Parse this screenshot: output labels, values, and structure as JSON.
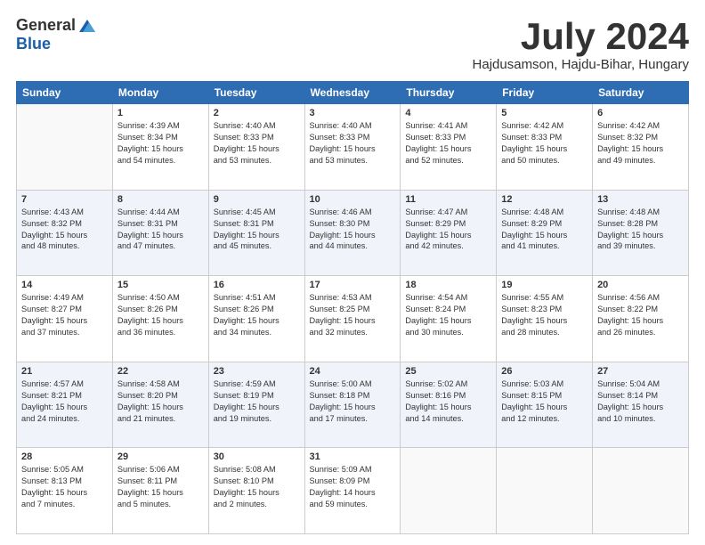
{
  "logo": {
    "general": "General",
    "blue": "Blue"
  },
  "header": {
    "month": "July 2024",
    "location": "Hajdusamson, Hajdu-Bihar, Hungary"
  },
  "weekdays": [
    "Sunday",
    "Monday",
    "Tuesday",
    "Wednesday",
    "Thursday",
    "Friday",
    "Saturday"
  ],
  "weeks": [
    [
      {
        "day": "",
        "text": ""
      },
      {
        "day": "1",
        "text": "Sunrise: 4:39 AM\nSunset: 8:34 PM\nDaylight: 15 hours\nand 54 minutes."
      },
      {
        "day": "2",
        "text": "Sunrise: 4:40 AM\nSunset: 8:33 PM\nDaylight: 15 hours\nand 53 minutes."
      },
      {
        "day": "3",
        "text": "Sunrise: 4:40 AM\nSunset: 8:33 PM\nDaylight: 15 hours\nand 53 minutes."
      },
      {
        "day": "4",
        "text": "Sunrise: 4:41 AM\nSunset: 8:33 PM\nDaylight: 15 hours\nand 52 minutes."
      },
      {
        "day": "5",
        "text": "Sunrise: 4:42 AM\nSunset: 8:33 PM\nDaylight: 15 hours\nand 50 minutes."
      },
      {
        "day": "6",
        "text": "Sunrise: 4:42 AM\nSunset: 8:32 PM\nDaylight: 15 hours\nand 49 minutes."
      }
    ],
    [
      {
        "day": "7",
        "text": "Sunrise: 4:43 AM\nSunset: 8:32 PM\nDaylight: 15 hours\nand 48 minutes."
      },
      {
        "day": "8",
        "text": "Sunrise: 4:44 AM\nSunset: 8:31 PM\nDaylight: 15 hours\nand 47 minutes."
      },
      {
        "day": "9",
        "text": "Sunrise: 4:45 AM\nSunset: 8:31 PM\nDaylight: 15 hours\nand 45 minutes."
      },
      {
        "day": "10",
        "text": "Sunrise: 4:46 AM\nSunset: 8:30 PM\nDaylight: 15 hours\nand 44 minutes."
      },
      {
        "day": "11",
        "text": "Sunrise: 4:47 AM\nSunset: 8:29 PM\nDaylight: 15 hours\nand 42 minutes."
      },
      {
        "day": "12",
        "text": "Sunrise: 4:48 AM\nSunset: 8:29 PM\nDaylight: 15 hours\nand 41 minutes."
      },
      {
        "day": "13",
        "text": "Sunrise: 4:48 AM\nSunset: 8:28 PM\nDaylight: 15 hours\nand 39 minutes."
      }
    ],
    [
      {
        "day": "14",
        "text": "Sunrise: 4:49 AM\nSunset: 8:27 PM\nDaylight: 15 hours\nand 37 minutes."
      },
      {
        "day": "15",
        "text": "Sunrise: 4:50 AM\nSunset: 8:26 PM\nDaylight: 15 hours\nand 36 minutes."
      },
      {
        "day": "16",
        "text": "Sunrise: 4:51 AM\nSunset: 8:26 PM\nDaylight: 15 hours\nand 34 minutes."
      },
      {
        "day": "17",
        "text": "Sunrise: 4:53 AM\nSunset: 8:25 PM\nDaylight: 15 hours\nand 32 minutes."
      },
      {
        "day": "18",
        "text": "Sunrise: 4:54 AM\nSunset: 8:24 PM\nDaylight: 15 hours\nand 30 minutes."
      },
      {
        "day": "19",
        "text": "Sunrise: 4:55 AM\nSunset: 8:23 PM\nDaylight: 15 hours\nand 28 minutes."
      },
      {
        "day": "20",
        "text": "Sunrise: 4:56 AM\nSunset: 8:22 PM\nDaylight: 15 hours\nand 26 minutes."
      }
    ],
    [
      {
        "day": "21",
        "text": "Sunrise: 4:57 AM\nSunset: 8:21 PM\nDaylight: 15 hours\nand 24 minutes."
      },
      {
        "day": "22",
        "text": "Sunrise: 4:58 AM\nSunset: 8:20 PM\nDaylight: 15 hours\nand 21 minutes."
      },
      {
        "day": "23",
        "text": "Sunrise: 4:59 AM\nSunset: 8:19 PM\nDaylight: 15 hours\nand 19 minutes."
      },
      {
        "day": "24",
        "text": "Sunrise: 5:00 AM\nSunset: 8:18 PM\nDaylight: 15 hours\nand 17 minutes."
      },
      {
        "day": "25",
        "text": "Sunrise: 5:02 AM\nSunset: 8:16 PM\nDaylight: 15 hours\nand 14 minutes."
      },
      {
        "day": "26",
        "text": "Sunrise: 5:03 AM\nSunset: 8:15 PM\nDaylight: 15 hours\nand 12 minutes."
      },
      {
        "day": "27",
        "text": "Sunrise: 5:04 AM\nSunset: 8:14 PM\nDaylight: 15 hours\nand 10 minutes."
      }
    ],
    [
      {
        "day": "28",
        "text": "Sunrise: 5:05 AM\nSunset: 8:13 PM\nDaylight: 15 hours\nand 7 minutes."
      },
      {
        "day": "29",
        "text": "Sunrise: 5:06 AM\nSunset: 8:11 PM\nDaylight: 15 hours\nand 5 minutes."
      },
      {
        "day": "30",
        "text": "Sunrise: 5:08 AM\nSunset: 8:10 PM\nDaylight: 15 hours\nand 2 minutes."
      },
      {
        "day": "31",
        "text": "Sunrise: 5:09 AM\nSunset: 8:09 PM\nDaylight: 14 hours\nand 59 minutes."
      },
      {
        "day": "",
        "text": ""
      },
      {
        "day": "",
        "text": ""
      },
      {
        "day": "",
        "text": ""
      }
    ]
  ]
}
